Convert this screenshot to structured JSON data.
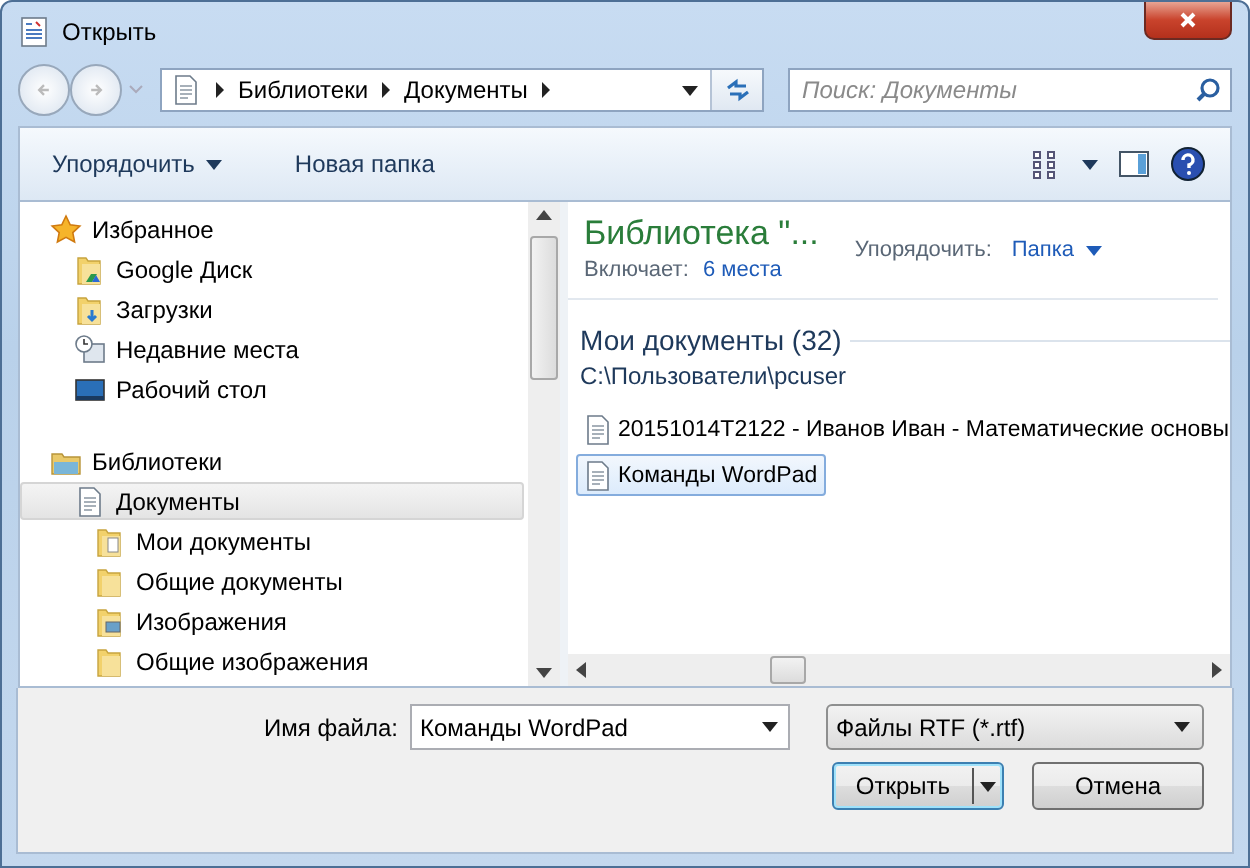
{
  "window": {
    "title": "Открыть"
  },
  "address": {
    "crumbs": [
      "Библиотеки",
      "Документы"
    ]
  },
  "search": {
    "placeholder": "Поиск: Документы"
  },
  "toolbar": {
    "organize": "Упорядочить",
    "new_folder": "Новая папка"
  },
  "nav": [
    {
      "label": "Избранное",
      "kind": "favorites",
      "selected": false,
      "children": [
        {
          "label": "Google Диск",
          "kind": "drive",
          "selected": false
        },
        {
          "label": "Загрузки",
          "kind": "downloads",
          "selected": false
        },
        {
          "label": "Недавние места",
          "kind": "recent",
          "selected": false
        },
        {
          "label": "Рабочий стол",
          "kind": "desktop",
          "selected": false
        }
      ]
    },
    {
      "label": "Библиотеки",
      "kind": "libraries",
      "selected": false,
      "children": [
        {
          "label": "Документы",
          "kind": "documents",
          "selected": true,
          "children": [
            {
              "label": "Мои документы",
              "kind": "documents",
              "selected": false
            },
            {
              "label": "Общие документы",
              "kind": "folder",
              "selected": false
            },
            {
              "label": "Изображения",
              "kind": "pictures",
              "selected": false
            },
            {
              "label": "Общие изображения",
              "kind": "folder",
              "selected": false
            }
          ]
        }
      ]
    }
  ],
  "library": {
    "title": "Библиотека \"...",
    "includes_label": "Включает:",
    "includes_link": "6 места",
    "arrange_label": "Упорядочить:",
    "arrange_value": "Папка"
  },
  "group": {
    "title": "Мои документы (32)",
    "path": "C:\\Пользователи\\pcuser"
  },
  "files": [
    {
      "name": "20151014T2122 - Иванов Иван - Математические основы",
      "selected": false
    },
    {
      "name": "Команды WordPad",
      "selected": true
    }
  ],
  "filename": {
    "label": "Имя файла:",
    "value": "Команды WordPad"
  },
  "filter": {
    "value": "Файлы RTF (*.rtf)"
  },
  "buttons": {
    "open": "Открыть",
    "cancel": "Отмена"
  }
}
